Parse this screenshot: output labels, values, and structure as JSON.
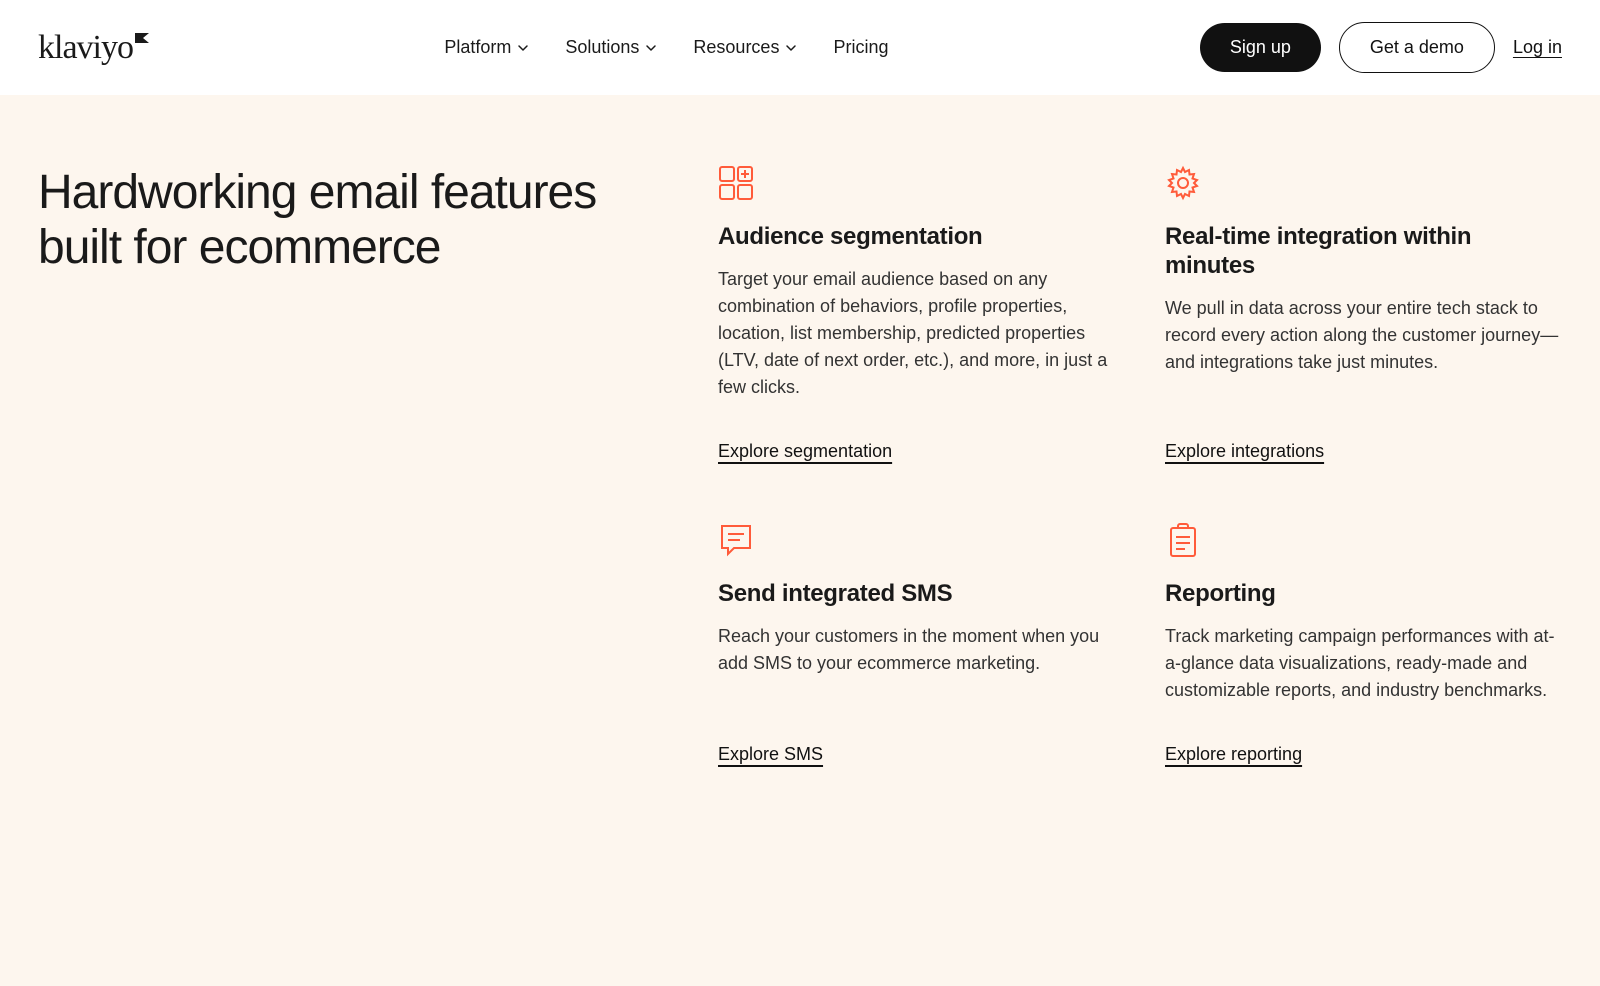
{
  "brand": "klaviyo",
  "nav": {
    "items": [
      {
        "label": "Platform",
        "hasDropdown": true
      },
      {
        "label": "Solutions",
        "hasDropdown": true
      },
      {
        "label": "Resources",
        "hasDropdown": true
      },
      {
        "label": "Pricing",
        "hasDropdown": false
      }
    ]
  },
  "actions": {
    "signup": "Sign up",
    "demo": "Get a demo",
    "login": "Log in"
  },
  "hero": {
    "title": "Hardworking email features built for ecommerce"
  },
  "features": [
    {
      "icon": "grid-icon",
      "title": "Audience segmentation",
      "desc": "Target your email audience based on any combination of behaviors, profile properties, location, list membership, predicted properties (LTV, date of next order, etc.), and more, in just a few clicks.",
      "link": "Explore segmentation"
    },
    {
      "icon": "gear-icon",
      "title": "Real-time integration within minutes",
      "desc": "We pull in data across your entire tech stack to record every action along the customer journey—and integrations take just minutes.",
      "link": "Explore integrations"
    },
    {
      "icon": "chat-icon",
      "title": "Send integrated SMS",
      "desc": "Reach your customers in the moment when you add SMS to your ecommerce marketing.",
      "link": "Explore SMS"
    },
    {
      "icon": "clipboard-icon",
      "title": "Reporting",
      "desc": "Track marketing campaign performances with at-a-glance data visualizations, ready-made and customizable reports, and industry benchmarks.",
      "link": "Explore reporting"
    }
  ],
  "colors": {
    "accent": "#ff5b3a",
    "heroBg": "#fdf6ee"
  }
}
